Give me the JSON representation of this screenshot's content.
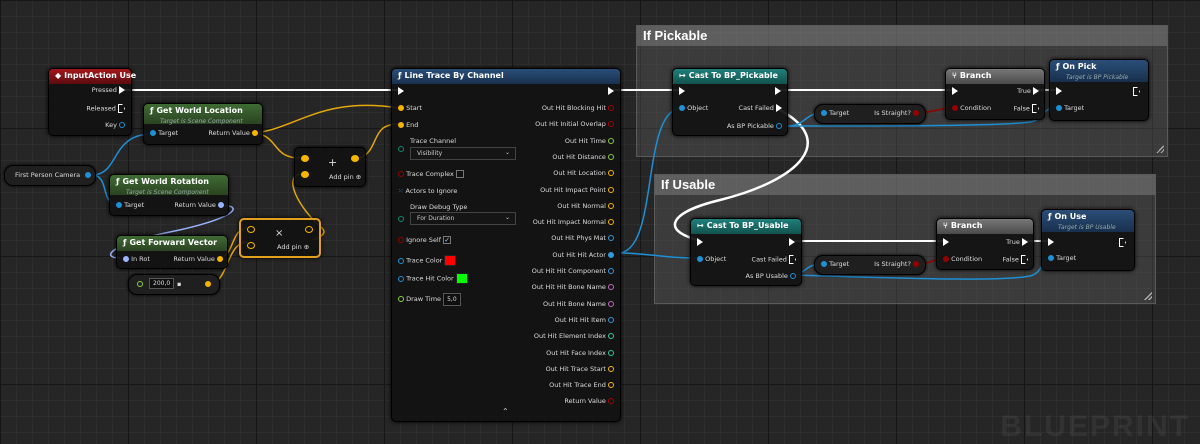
{
  "comments": {
    "pickable": "If Pickable",
    "usable": "If Usable"
  },
  "input_action": {
    "title": "InputAction Use",
    "pressed": "Pressed",
    "released": "Released",
    "key": "Key"
  },
  "camera": {
    "label": "First Person Camera"
  },
  "get_world_location": {
    "title": "Get World Location",
    "subtitle": "Target is Scene Component",
    "target": "Target",
    "ret": "Return Value"
  },
  "get_world_rotation": {
    "title": "Get World Rotation",
    "subtitle": "Target is Scene Component",
    "target": "Target",
    "ret": "Return Value"
  },
  "get_forward_vector": {
    "title": "Get Forward Vector",
    "in": "In Rot",
    "ret": "Return Value"
  },
  "float_const": {
    "value": "200,0"
  },
  "add_top": {
    "symbol": "+",
    "add_pin": "Add pin"
  },
  "multiply": {
    "symbol": "×",
    "add_pin": "Add pin"
  },
  "line_trace": {
    "title": "Line Trace By Channel",
    "start": "Start",
    "end": "End",
    "trace_channel": "Trace Channel",
    "channel_value": "Visibility",
    "trace_complex": "Trace Complex",
    "actors_to_ignore": "Actors to Ignore",
    "draw_debug_type": "Draw Debug Type",
    "debug_value": "For Duration",
    "ignore_self": "Ignore Self",
    "trace_color": "Trace Color",
    "trace_hit_color": "Trace Hit Color",
    "draw_time": "Draw Time",
    "draw_time_value": "5,0",
    "outputs": [
      "Out Hit Blocking Hit",
      "Out Hit Initial Overlap",
      "Out Hit Time",
      "Out Hit Distance",
      "Out Hit Location",
      "Out Hit Impact Point",
      "Out Hit Normal",
      "Out Hit Impact Normal",
      "Out Hit Phys Mat",
      "Out Hit Hit Actor",
      "Out Hit Hit Component",
      "Out Hit Hit Bone Name",
      "Out Hit Bone Name",
      "Out Hit Hit Item",
      "Out Hit Element Index",
      "Out Hit Face Index",
      "Out Hit Trace Start",
      "Out Hit Trace End",
      "Return Value"
    ],
    "output_colors": [
      "#a00",
      "#a00",
      "#8c3",
      "#8c3",
      "#f5b400",
      "#f5b400",
      "#f5b400",
      "#f5b400",
      "#39d",
      "#39d",
      "#39d",
      "#c6c",
      "#c6c",
      "#39d",
      "#3c9",
      "#3c9",
      "#f5b400",
      "#f5b400",
      "#a00"
    ]
  },
  "cast_pickable": {
    "title": "Cast To BP_Pickable",
    "object": "Object",
    "cast_failed": "Cast Failed",
    "as": "As BP Pickable"
  },
  "cast_usable": {
    "title": "Cast To BP_Usable",
    "object": "Object",
    "cast_failed": "Cast Failed",
    "as": "As BP Usable"
  },
  "is_straight_1": {
    "target": "Target",
    "label": "Is Straight?"
  },
  "is_straight_2": {
    "target": "Target",
    "label": "Is Straight?"
  },
  "branch_1": {
    "title": "Branch",
    "condition": "Condition",
    "true": "True",
    "false": "False"
  },
  "branch_2": {
    "title": "Branch",
    "condition": "Condition",
    "true": "True",
    "false": "False"
  },
  "on_pick": {
    "title": "On Pick",
    "subtitle": "Target is BP Pickable",
    "target": "Target"
  },
  "on_use": {
    "title": "On Use",
    "subtitle": "Target is BP Usable",
    "target": "Target"
  },
  "watermark": "BLUEPRINT",
  "colors": {
    "exec": "#ffffff",
    "object": "#1e90d6",
    "vector": "#f5b400",
    "rotator": "#9ab4ff",
    "float": "#8bd13c",
    "bool": "#950000"
  }
}
